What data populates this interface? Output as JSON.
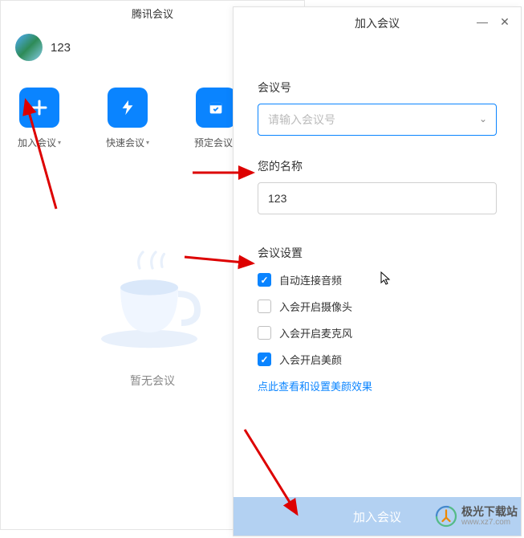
{
  "main": {
    "title": "腾讯会议",
    "username": "123",
    "actions": [
      {
        "label": "加入会议"
      },
      {
        "label": "快速会议"
      },
      {
        "label": "预定会议"
      }
    ],
    "empty_text": "暂无会议"
  },
  "dialog": {
    "title": "加入会议",
    "meeting_id_label": "会议号",
    "meeting_id_placeholder": "请输入会议号",
    "name_label": "您的名称",
    "name_value": "123",
    "settings_label": "会议设置",
    "options": [
      {
        "label": "自动连接音频",
        "checked": true
      },
      {
        "label": "入会开启摄像头",
        "checked": false
      },
      {
        "label": "入会开启麦克风",
        "checked": false
      },
      {
        "label": "入会开启美颜",
        "checked": true
      }
    ],
    "beauty_link": "点此查看和设置美颜效果",
    "join_button": "加入会议"
  },
  "watermark": {
    "name": "极光下载站",
    "url": "www.xz7.com"
  }
}
